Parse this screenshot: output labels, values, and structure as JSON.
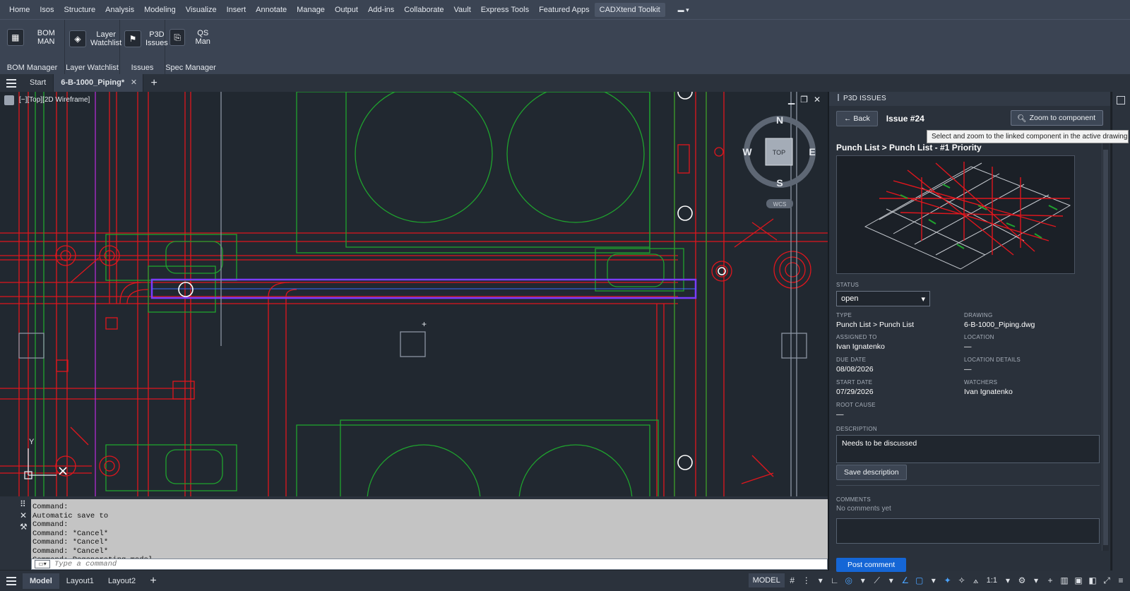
{
  "ribbon": {
    "tabs": [
      "Home",
      "Isos",
      "Structure",
      "Analysis",
      "Modeling",
      "Visualize",
      "Insert",
      "Annotate",
      "Manage",
      "Output",
      "Add-ins",
      "Collaborate",
      "Vault",
      "Express Tools",
      "Featured Apps",
      "CADXtend Toolkit"
    ],
    "active_tab": "CADXtend Toolkit",
    "groups": [
      {
        "button": "BOM MAN",
        "label": "BOM Manager",
        "icon": "table-icon"
      },
      {
        "button": "Layer\nWatchlist",
        "label": "Layer Watchlist",
        "icon": "layers-icon"
      },
      {
        "button": "P3D\nIssues",
        "label": "Issues",
        "icon": "flag-icon"
      },
      {
        "button": "QS Man",
        "label": "Spec Manager",
        "icon": "document-icon"
      }
    ]
  },
  "file_tabs": {
    "start": "Start",
    "active": "6-B-1000_Piping*"
  },
  "viewport": {
    "label": "[−][Top][2D Wireframe]",
    "viewcube": {
      "n": "N",
      "s": "S",
      "e": "E",
      "w": "W",
      "top": "TOP",
      "wcs": "WCS"
    },
    "ucs_y": "Y"
  },
  "command_line": {
    "history": [
      "Command:",
      "Automatic save to",
      "Command:",
      "Command: *Cancel*",
      "Command: *Cancel*",
      "Command: *Cancel*",
      "Command: Regenerating model."
    ],
    "placeholder": "Type a command"
  },
  "layout_tabs": [
    "Model",
    "Layout1",
    "Layout2"
  ],
  "statusbar": {
    "model": "MODEL",
    "scale": "1:1"
  },
  "issues_panel": {
    "title": "P3D ISSUES",
    "back": "← Back",
    "issue_number": "Issue #24",
    "zoom_button": "Zoom to component",
    "tooltip": "Select and zoom to the linked component in the active drawing",
    "issue_title": "Punch List > Punch List - #1 Priority",
    "status_label": "STATUS",
    "status_value": "open",
    "fields": {
      "type_label": "TYPE",
      "type_value": "Punch List > Punch List",
      "drawing_label": "DRAWING",
      "drawing_value": "6-B-1000_Piping.dwg",
      "assigned_label": "ASSIGNED TO",
      "assigned_value": "Ivan Ignatenko",
      "location_label": "LOCATION",
      "location_value": "—",
      "due_label": "DUE DATE",
      "due_value": "08/08/2026",
      "location_details_label": "LOCATION DETAILS",
      "location_details_value": "—",
      "start_label": "START DATE",
      "start_value": "07/29/2026",
      "watchers_label": "WATCHERS",
      "watchers_value": "Ivan Ignatenko",
      "root_cause_label": "ROOT CAUSE",
      "root_cause_value": "—"
    },
    "description_label": "DESCRIPTION",
    "description_value": "Needs to be discussed",
    "save_description": "Save description",
    "comments_label": "COMMENTS",
    "no_comments": "No comments yet",
    "post_comment": "Post comment"
  },
  "colors": {
    "accent": "#1566d6",
    "pipe_red": "#e0161d",
    "equipment_green": "#1fa32e",
    "selection_purple": "#7a3cff",
    "background": "#212830"
  }
}
